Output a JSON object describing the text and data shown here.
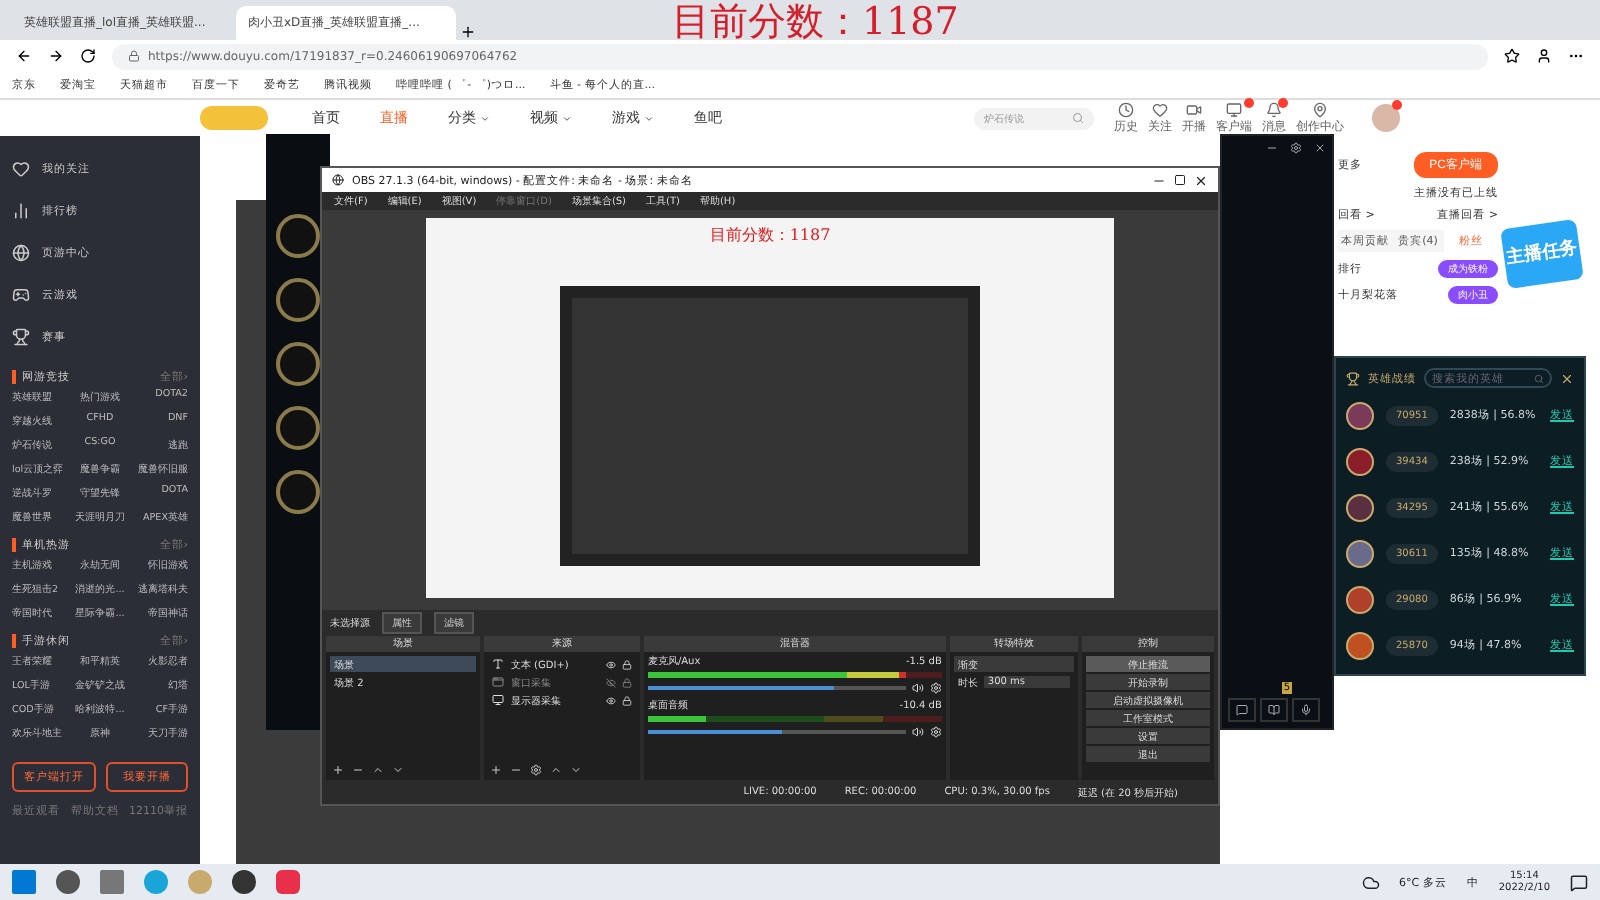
{
  "overlay_score": "目前分数：1187",
  "browser": {
    "tabs": [
      {
        "title": "英雄联盟直播_lol直播_英雄联盟...",
        "selected": false
      },
      {
        "title": "肉小丑xD直播_英雄联盟直播_...",
        "selected": true
      }
    ],
    "url": "https://www.douyu.com/17191837_r=0.24606190697064762",
    "bookmarks": [
      "京东",
      "爱淘宝",
      "天猫超市",
      "百度一下",
      "爱奇艺",
      "腾讯视频",
      "哔哩哔哩 ( ゜- ゜)つロ...",
      "斗鱼 - 每个人的直..."
    ]
  },
  "site_header": {
    "nav": [
      {
        "label": "首页",
        "selected": false,
        "dropdown": false
      },
      {
        "label": "直播",
        "selected": true,
        "dropdown": false
      },
      {
        "label": "分类",
        "selected": false,
        "dropdown": true
      },
      {
        "label": "视频",
        "selected": false,
        "dropdown": true
      },
      {
        "label": "游戏",
        "selected": false,
        "dropdown": true
      },
      {
        "label": "鱼吧",
        "selected": false,
        "dropdown": false
      }
    ],
    "search_placeholder": "炉石传说",
    "actions": [
      {
        "kind": "history",
        "label": "历史",
        "badge": false
      },
      {
        "kind": "follow",
        "label": "关注",
        "badge": false
      },
      {
        "kind": "stream",
        "label": "开播",
        "badge": false
      },
      {
        "kind": "client",
        "label": "客户端",
        "badge": true
      },
      {
        "kind": "message",
        "label": "消息",
        "badge": true
      },
      {
        "kind": "creator",
        "label": "创作中心",
        "badge": false
      }
    ],
    "avatar_badge": true
  },
  "sidebar": {
    "items": [
      {
        "kind": "follow",
        "label": "我的关注"
      },
      {
        "kind": "rank",
        "label": "排行榜"
      },
      {
        "kind": "webgame",
        "label": "页游中心"
      },
      {
        "kind": "cloud",
        "label": "云游戏"
      },
      {
        "kind": "event",
        "label": "赛事"
      }
    ],
    "sections": [
      {
        "title": "网游竞技",
        "more": "全部›",
        "games": [
          "英雄联盟",
          "热门游戏",
          "DOTA2",
          "穿越火线",
          "CFHD",
          "DNF",
          "炉石传说",
          "CS:GO",
          "逃跑",
          "lol云顶之弈",
          "魔兽争霸",
          "魔兽怀旧服",
          "逆战斗罗",
          "守望先锋",
          "DOTA",
          "魔兽世界",
          "天涯明月刀",
          "APEX英雄"
        ]
      },
      {
        "title": "单机热游",
        "more": "全部›",
        "games": [
          "主机游戏",
          "永劫无间",
          "怀旧游戏",
          "生死狙击2",
          "消逝的光...",
          "逃离塔科夫",
          "帝国时代",
          "星际争霸...",
          "帝国神话"
        ]
      },
      {
        "title": "手游休闲",
        "more": "全部›",
        "games": [
          "王者荣耀",
          "和平精英",
          "火影忍者",
          "LOL手游",
          "金铲铲之战",
          "幻塔",
          "COD手游",
          "哈利波特...",
          "CF手游",
          "欢乐斗地主",
          "原神",
          "天刀手游"
        ]
      }
    ],
    "buttons": [
      "客户端打开",
      "我要开播"
    ],
    "footer": [
      "最近观看",
      "帮助文档",
      "12110举报"
    ]
  },
  "right_panel": {
    "more": "更多",
    "pc_client": "PC客户端",
    "notice": "主播没有已上线",
    "links": [
      "回看 >",
      "直播回看 >"
    ],
    "tabs": [
      {
        "label": "本周贡献",
        "selected": false
      },
      {
        "label": "贵宾(4)",
        "selected": false
      },
      {
        "label": "粉丝",
        "selected": true
      }
    ],
    "rows": [
      {
        "label": "排行",
        "badge": "成为铁粉"
      },
      {
        "label": "十月梨花落",
        "badge": "肉小丑"
      }
    ],
    "promo": "主播任务"
  },
  "obs": {
    "title": "OBS 27.1.3 (64-bit, windows) - 配置文件: 未命名 - 场景: 未命名",
    "menu": [
      {
        "label": "文件(F)",
        "disabled": false
      },
      {
        "label": "编辑(E)",
        "disabled": false
      },
      {
        "label": "视图(V)",
        "disabled": false
      },
      {
        "label": "停靠窗口(D)",
        "disabled": true
      },
      {
        "label": "场景集合(S)",
        "disabled": false
      },
      {
        "label": "工具(T)",
        "disabled": false
      },
      {
        "label": "帮助(H)",
        "disabled": false
      }
    ],
    "preview_score": "目前分数：1187",
    "source_bar": {
      "label": "未选择源",
      "buttons": [
        "属性",
        "滤镜"
      ]
    },
    "scenes": {
      "title": "场景",
      "items": [
        {
          "label": "场景",
          "selected": true
        },
        {
          "label": "场景 2",
          "selected": false
        }
      ]
    },
    "sources": {
      "title": "来源",
      "items": [
        {
          "kind": "text",
          "label": "文本 (GDI+)",
          "visible": true
        },
        {
          "kind": "window",
          "label": "窗口采集",
          "visible": false
        },
        {
          "kind": "display",
          "label": "显示器采集",
          "visible": true
        }
      ]
    },
    "mixer": {
      "title": "混音器",
      "channels": [
        {
          "name": "麦克风/Aux",
          "reading": "-1.5 dB",
          "level": 0.88,
          "volume": {
            "level": 0.72
          }
        },
        {
          "name": "桌面音频",
          "reading": "-10.4 dB",
          "level": 0.2,
          "volume": {
            "level": 0.52
          }
        }
      ]
    },
    "transitions": {
      "title": "转场特效",
      "type": "渐变",
      "duration_label": "时长",
      "duration": "300 ms"
    },
    "controls": {
      "title": "控制",
      "buttons": [
        {
          "label": "停止推流",
          "selected": true
        },
        {
          "label": "开始录制",
          "selected": false
        },
        {
          "label": "启动虚拟摄像机",
          "selected": false
        },
        {
          "label": "工作室模式",
          "selected": false
        },
        {
          "label": "设置",
          "selected": false
        },
        {
          "label": "退出",
          "selected": false
        }
      ]
    },
    "status": [
      "LIVE: 00:00:00",
      "REC: 00:00:00",
      "CPU: 0.3%, 30.00 fps",
      "延迟 (在 20 秒后开始)"
    ]
  },
  "hero_panel": {
    "title": "英雄战绩",
    "search_placeholder": "搜索我的英雄",
    "rows": [
      {
        "score": "70951",
        "record": "2838场 | 56.8%",
        "color": "#7a3a5a",
        "action": "发送"
      },
      {
        "score": "39434",
        "record": "238场 | 52.9%",
        "color": "#8a1f2a",
        "action": "发送"
      },
      {
        "score": "34295",
        "record": "241场 | 55.6%",
        "color": "#5a3040",
        "action": "发送"
      },
      {
        "score": "30611",
        "record": "135场 | 48.8%",
        "color": "#6a6a8a",
        "action": "发送"
      },
      {
        "score": "29080",
        "record": "86场 | 56.9%",
        "color": "#b0402a",
        "action": "发送"
      },
      {
        "score": "25870",
        "record": "94场 | 47.8%",
        "color": "#c05020",
        "action": "发送"
      }
    ]
  },
  "lol_client": {
    "badge": "5"
  },
  "taskbar": {
    "weather": "6°C 多云",
    "ime": "中",
    "time": "15:14",
    "date": "2022/2/10"
  }
}
